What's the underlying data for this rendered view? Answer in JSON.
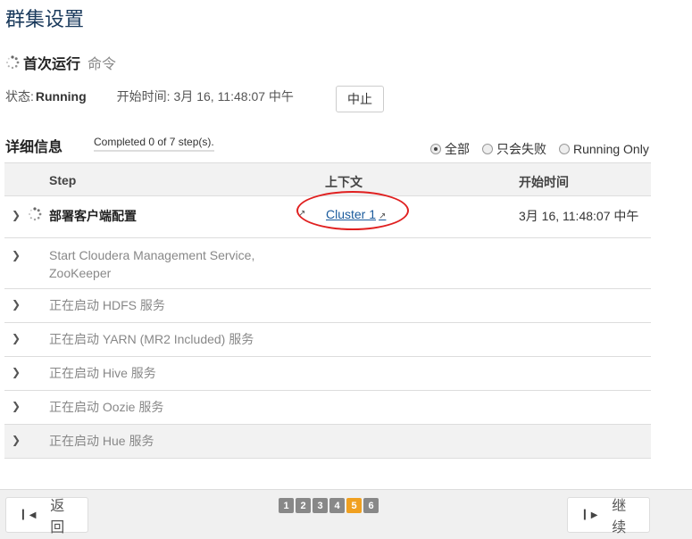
{
  "page": {
    "title": "群集设置"
  },
  "command": {
    "title": "首次运行",
    "subtitle": "命令"
  },
  "status": {
    "label": "状态:",
    "value": "Running",
    "start_label": "开始时间:",
    "start_value": "3月 16, 11:48:07 中午",
    "stop_label": "中止"
  },
  "details": {
    "title": "详细信息",
    "progress": "Completed 0 of 7 step(s).",
    "filters": [
      {
        "label": "全部",
        "selected": true
      },
      {
        "label": "只会失败",
        "selected": false
      },
      {
        "label": "Running Only",
        "selected": false
      }
    ]
  },
  "table": {
    "headers": {
      "step": "Step",
      "context": "上下文",
      "start_time": "开始时间"
    },
    "rows": [
      {
        "step": "部署客户端配置",
        "context": "Cluster 1",
        "start_time": "3月 16, 11:48:07 中午",
        "active": true
      },
      {
        "step_line1": "Start Cloudera Management Service,",
        "step_line2": "ZooKeeper"
      },
      {
        "step": "正在启动 HDFS 服务"
      },
      {
        "step": "正在启动 YARN (MR2 Included) 服务"
      },
      {
        "step": "正在启动 Hive 服务"
      },
      {
        "step": "正在启动 Oozie 服务"
      },
      {
        "step": "正在启动 Hue 服务"
      }
    ]
  },
  "footer": {
    "back_label": "返回",
    "next_label": "继续",
    "pages": [
      "1",
      "2",
      "3",
      "4",
      "5",
      "6"
    ],
    "current_page": "5"
  },
  "colors": {
    "accent": "#f0a020",
    "annotation": "#e02020",
    "link": "#1a5a9c"
  }
}
